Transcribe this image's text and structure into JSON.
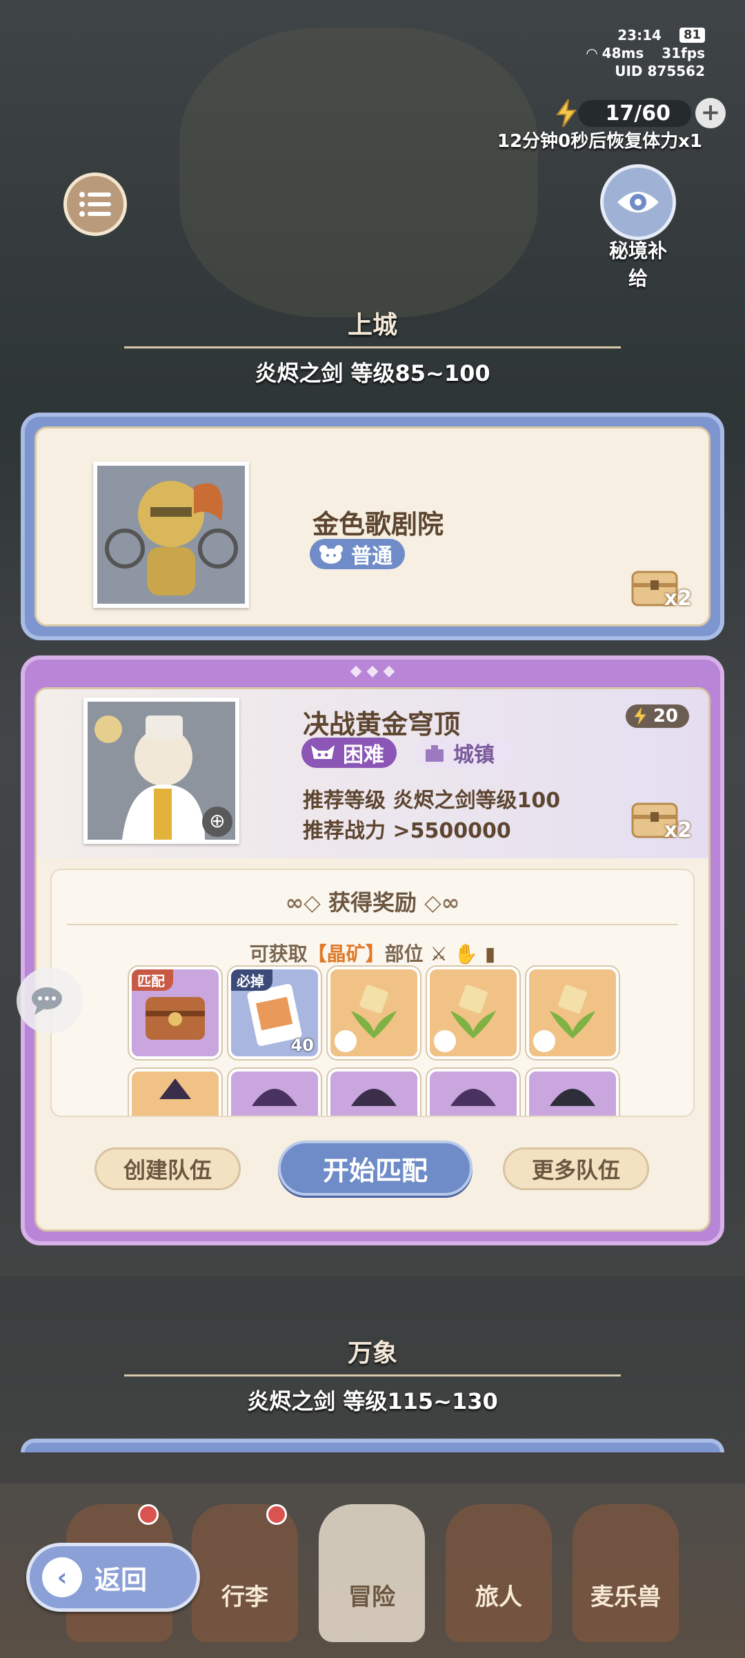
{
  "status": {
    "time": "23:14",
    "battery": "81",
    "ping": "48ms",
    "fps": "31fps",
    "uid": "UID  875562"
  },
  "stamina": {
    "value": "17/60",
    "recover_text": "12分钟0秒后恢复体力x1"
  },
  "secret_supply": {
    "label": "秘境补给"
  },
  "section_upper": {
    "title": "上城",
    "subtitle": "炎烬之剑  等级85~100"
  },
  "dungeon1": {
    "name": "金色歌剧院",
    "difficulty": "普通",
    "chest_multiplier": "x2"
  },
  "dungeon2": {
    "name": "决战黄金穹顶",
    "difficulty": "困难",
    "area": "城镇",
    "energy_cost": "20",
    "rec_level": "推荐等级 炎烬之剑等级100",
    "rec_power": "推荐战力  >5500000",
    "chest_multiplier": "x2"
  },
  "rewards": {
    "title": "获得奖励",
    "parts_prefix": "可获取",
    "parts_highlight": "【晶矿】",
    "parts_suffix": "部位",
    "items": [
      {
        "badge": "匹配",
        "qty": ""
      },
      {
        "badge": "必掉",
        "qty": "40"
      },
      {
        "badge": "",
        "qty": ""
      },
      {
        "badge": "",
        "qty": ""
      },
      {
        "badge": "",
        "qty": ""
      }
    ]
  },
  "actions": {
    "create_team": "创建队伍",
    "start_match": "开始匹配",
    "more_teams": "更多队伍"
  },
  "section_wanxiang": {
    "title": "万象",
    "subtitle": "炎烬之剑  等级115~130"
  },
  "nav": {
    "back": "返回",
    "bag": "行李",
    "adventure": "冒险",
    "traveler": "旅人",
    "pet": "麦乐兽"
  },
  "colors": {
    "accent_blue": "#6f8cc8",
    "accent_purple": "#b985d6",
    "highlight_orange": "#e07a2a",
    "parchment": "#f6efe2"
  }
}
